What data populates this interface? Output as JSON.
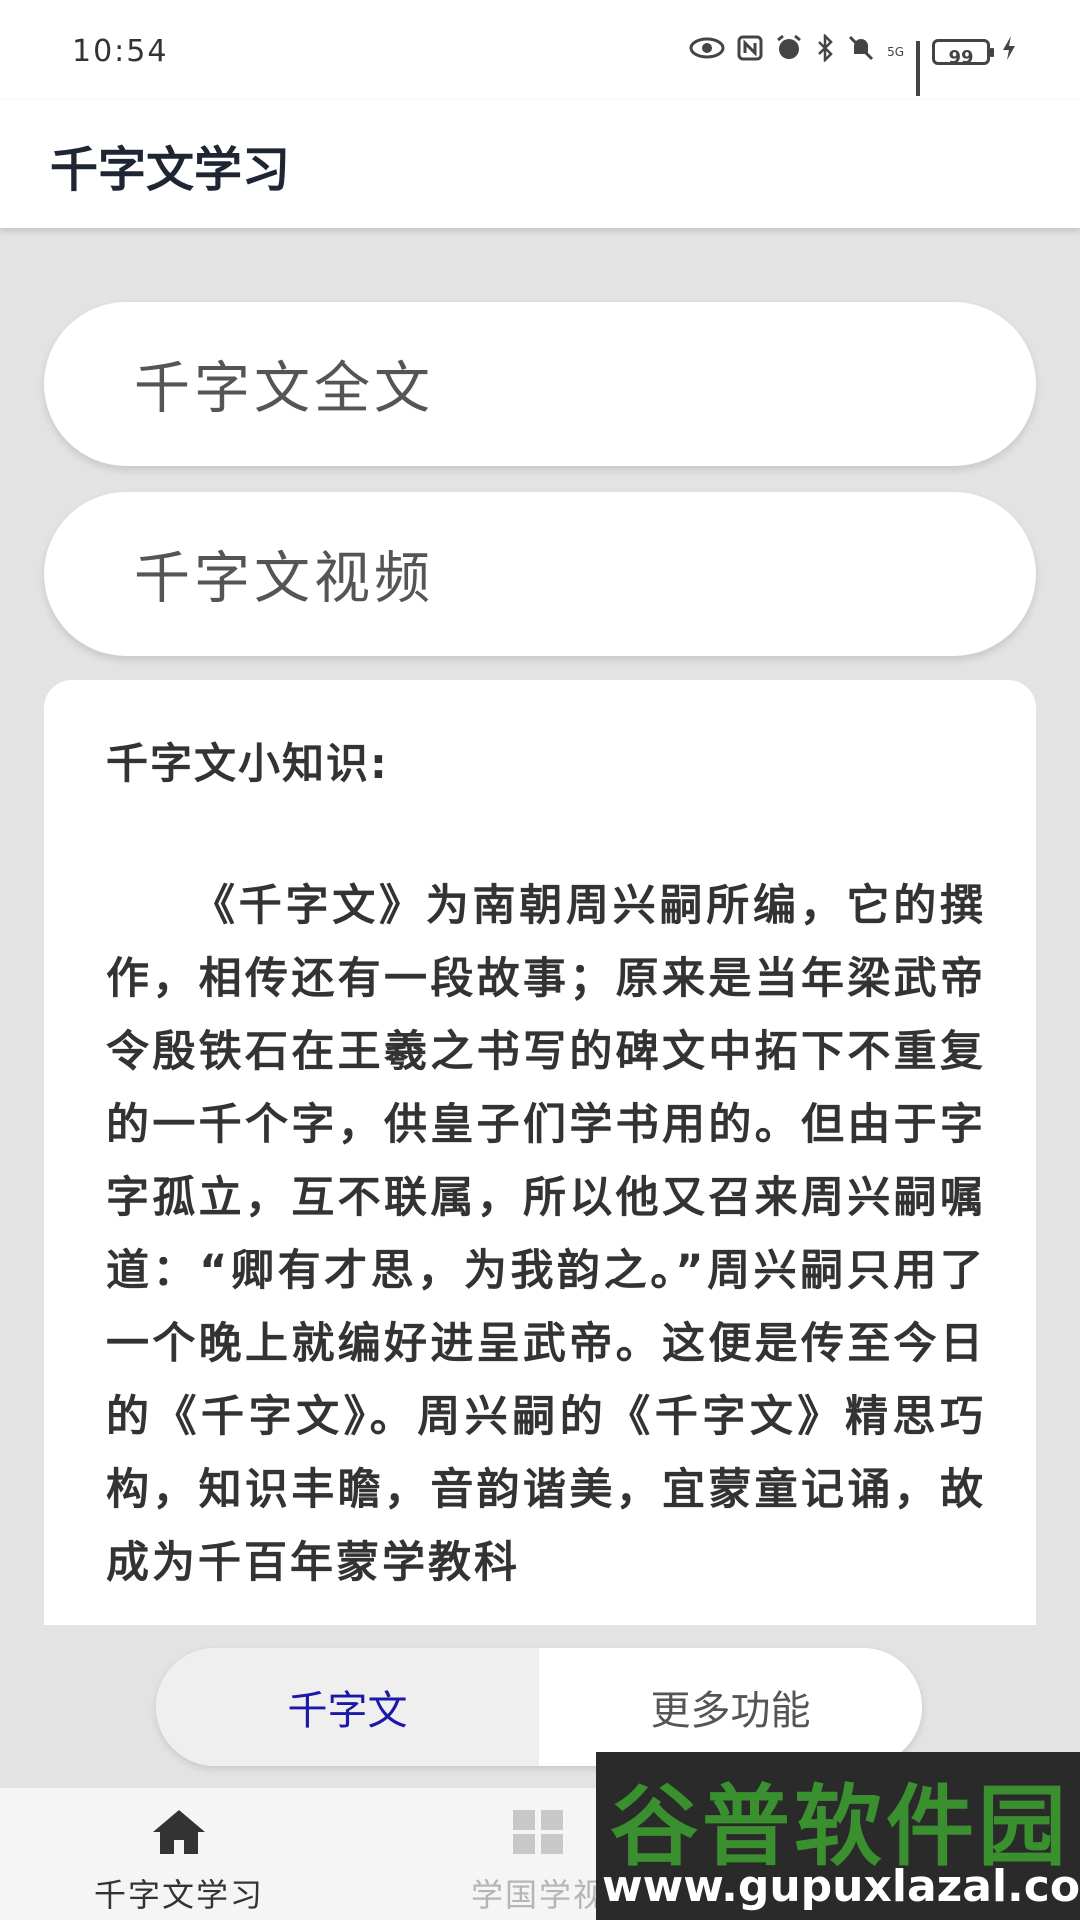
{
  "status_bar": {
    "time": "10:54",
    "signal_label": "5G",
    "battery": "99"
  },
  "app_bar": {
    "title": "千字文学习"
  },
  "buttons": {
    "full_text": "千字文全文",
    "video": "千字文视频"
  },
  "info": {
    "title": "千字文小知识:",
    "body": "《千字文》为南朝周兴嗣所编，它的撰作，相传还有一段故事；原来是当年梁武帝令殷铁石在王羲之书写的碑文中拓下不重复的一千个字，供皇子们学书用的。但由于字字孤立，互不联属，所以他又召来周兴嗣嘱道：“卿有才思，为我韵之。”周兴嗣只用了一个晚上就编好进呈武帝。这便是传至今日的《千字文》。周兴嗣的《千字文》精思巧构，知识丰瞻，音韵谐美，宜蒙童记诵，故成为千百年蒙学教科"
  },
  "segment": {
    "active": "千字文",
    "inactive": "更多功能",
    "active_color": "#1a1aa6"
  },
  "bottom_nav": {
    "items": [
      {
        "label": "千字文学习",
        "icon": "home-icon"
      },
      {
        "label": "学国学视",
        "icon": "grid-icon"
      }
    ]
  },
  "watermark": {
    "main": "谷普软件园",
    "url": "www.gupuxlazal.com"
  }
}
